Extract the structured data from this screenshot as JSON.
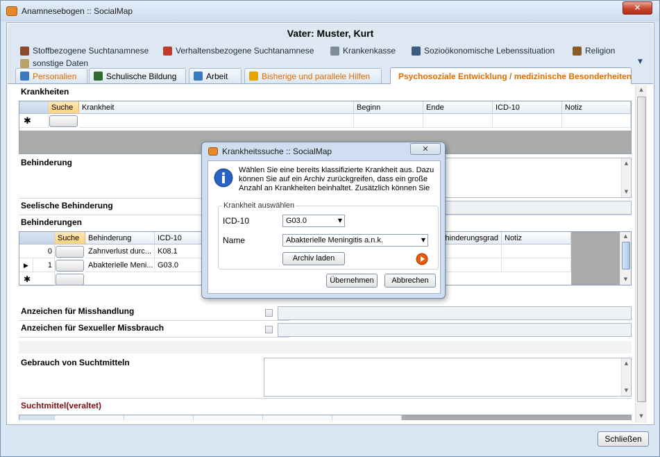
{
  "window": {
    "title": "Anamnesebogen :: SocialMap",
    "close_glyph": "✕"
  },
  "header": {
    "title": "Vater: Muster, Kurt"
  },
  "toolbar": {
    "items": [
      {
        "label": "Stoffbezogene Suchtanamnese",
        "icon": "substance-icon",
        "color": "#8b4a2f"
      },
      {
        "label": "Verhaltensbezogene Suchtanamnese",
        "icon": "cart-icon",
        "color": "#c0392b"
      },
      {
        "label": "Krankenkasse",
        "icon": "cutlery-icon",
        "color": "#7f8c99"
      },
      {
        "label": "Sozioökonomische Lebenssituation",
        "icon": "people-icon",
        "color": "#3d5a80"
      },
      {
        "label": "Religion",
        "icon": "book-icon",
        "color": "#8b5a2b"
      },
      {
        "label": "sonstige Daten",
        "icon": "notepad-icon",
        "color": "#b9a36a"
      }
    ],
    "more_glyph": "▼"
  },
  "tabs": [
    {
      "label": "Personalien",
      "icon": "person-card-icon",
      "color": "#3a78c2"
    },
    {
      "label": "Schulische Bildung",
      "icon": "blackboard-icon",
      "color": "#2f6b2f"
    },
    {
      "label": "Arbeit",
      "icon": "document-icon",
      "color": "#3a78c2"
    },
    {
      "label": "Bisherige und parallele Hilfen",
      "icon": "lifebuoy-icon",
      "color": "#e6a400"
    },
    {
      "label": "Psychosoziale Entwicklung / medizinische Besonderheiten",
      "icon": "figure-icon",
      "color": "#e8c100",
      "active": true
    }
  ],
  "sections": {
    "krankheiten": {
      "label": "Krankheiten",
      "columns": [
        "Suche",
        "Krankheit",
        "Beginn",
        "Ende",
        "ICD-10",
        "Notiz"
      ],
      "new_row_marker": "✱"
    },
    "behinderung": {
      "label": "Behinderung"
    },
    "seelische": {
      "label": "Seelische Behinderung"
    },
    "behinderungen": {
      "label": "Behinderungen",
      "columns": [
        "Suche",
        "Behinderung",
        "ICD-10",
        "hinderungsgrad",
        "Notiz"
      ],
      "rows": [
        {
          "index": "0",
          "name": "Zahnverlust durc...",
          "icd": "K08.1",
          "marker": ""
        },
        {
          "index": "1",
          "name": "Abakterielle Meni...",
          "icd": "G03.0",
          "marker": "▶"
        }
      ],
      "new_row_marker": "✱"
    },
    "misshandlung": {
      "label": "Anzeichen für Misshandlung",
      "checked": false
    },
    "missbrauch": {
      "label": "Anzeichen für Sexueller Missbrauch",
      "checked": false
    },
    "suchtmittel": {
      "label": "Gebrauch von Suchtmitteln"
    },
    "suchtmittel_alt": {
      "label": "Suchtmittel(veraltet)",
      "color": "#7a1010"
    }
  },
  "footer": {
    "close_button": "Schließen"
  },
  "dialog": {
    "title": "Krankheitssuche :: SocialMap",
    "close_glyph": "✕",
    "info_icon": "info-icon",
    "info_text": "Wählen Sie eine bereits klassifizierte Krankheit aus. Dazu können Sie auf ein Archiv zurückgreifen, dass ein große Anzahl an Krankheiten beinhaltet. Zusätzlich können Sie ...",
    "group_label": "Krankheit auswählen",
    "icd_label": "ICD-10",
    "icd_value": "G03.0",
    "name_label": "Name",
    "name_value": "Abakterielle Meningitis a.n.k.",
    "archive_button": "Archiv laden",
    "ok_button": "Übernehmen",
    "cancel_button": "Abbrechen",
    "play_icon": "play-icon",
    "play_color": "#e45b0a"
  }
}
